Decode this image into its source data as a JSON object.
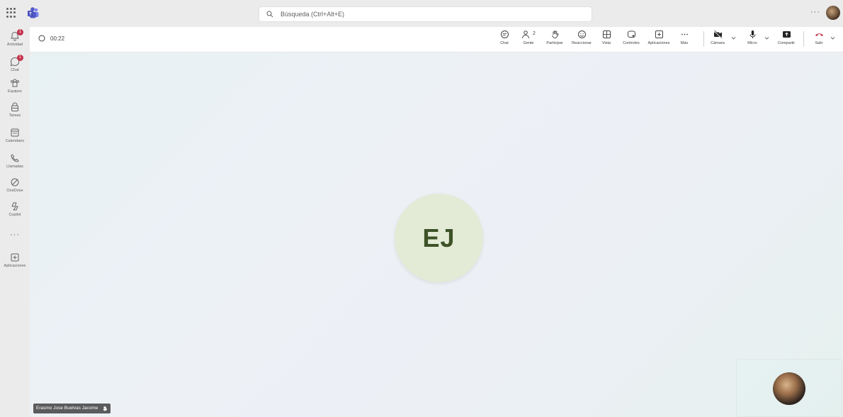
{
  "titlebar": {
    "search_placeholder": "Búsqueda (Ctrl+Alt+E)",
    "more_label": "···"
  },
  "rail": {
    "items": [
      {
        "label": "Actividad",
        "badge": "1",
        "icon": "bell-icon"
      },
      {
        "label": "Chat",
        "badge": "1",
        "icon": "chat-icon"
      },
      {
        "label": "Equipos",
        "icon": "teams-icon"
      },
      {
        "label": "Tareas",
        "icon": "tasks-icon"
      },
      {
        "label": "Calendario",
        "icon": "calendar-icon"
      },
      {
        "label": "Llamadas",
        "icon": "phone-icon"
      },
      {
        "label": "OneDrive",
        "icon": "cloud-icon"
      },
      {
        "label": "Copilot",
        "icon": "copilot-icon"
      }
    ],
    "more_label": "···",
    "apps_label": "Aplicaciones"
  },
  "meeting": {
    "timer": "00:22",
    "tools": {
      "chat": "Chat",
      "people": "Gente",
      "people_count": "2",
      "raise": "Participar",
      "react": "Reaccionar",
      "view": "Vista",
      "controls": "Controles",
      "apps": "Aplicaciones",
      "more": "Más",
      "camera": "Cámara",
      "mic": "Micro",
      "share": "Compartir",
      "leave": "Salir"
    }
  },
  "stage": {
    "initials": "EJ",
    "participant_name": "Erasmo Jose Buelvas Jacome"
  },
  "colors": {
    "teams_purple": "#5b5fc7",
    "leave_red": "#c4314b",
    "badge_red": "#c4314b",
    "avatar_bg": "#e3ead6",
    "avatar_text": "#3d5227"
  }
}
